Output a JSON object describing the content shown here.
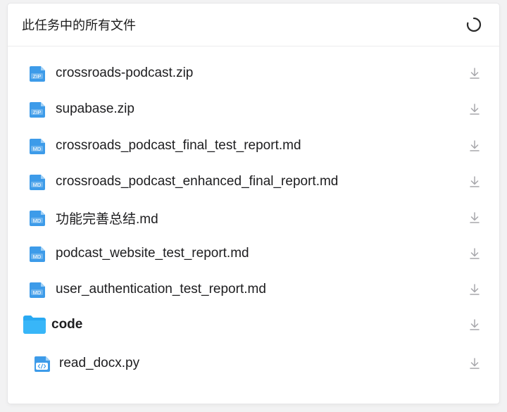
{
  "panel": {
    "title": "此任务中的所有文件",
    "refresh_icon": "loading-spinner-icon"
  },
  "files": [
    {
      "name": "crossroads-podcast.zip",
      "type": "zip",
      "badge": "ZIP"
    },
    {
      "name": "supabase.zip",
      "type": "zip",
      "badge": "ZIP"
    },
    {
      "name": "crossroads_podcast_final_test_report.md",
      "type": "md",
      "badge": "MD"
    },
    {
      "name": "crossroads_podcast_enhanced_final_report.md",
      "type": "md",
      "badge": "MD"
    },
    {
      "name": "功能完善总结.md",
      "type": "md",
      "badge": "MD"
    },
    {
      "name": "podcast_website_test_report.md",
      "type": "md",
      "badge": "MD"
    },
    {
      "name": "user_authentication_test_report.md",
      "type": "md",
      "badge": "MD"
    },
    {
      "name": "code",
      "type": "folder"
    },
    {
      "name": "read_docx.py",
      "type": "code",
      "nested": true
    }
  ],
  "colors": {
    "icon_blue": "#3d9be9",
    "folder_blue": "#29a9f2",
    "download_gray": "#a7a7ab"
  },
  "icons": {
    "download": "download-icon",
    "zip": "zip-file-icon",
    "md": "markdown-file-icon",
    "folder": "folder-icon",
    "code": "code-file-icon"
  }
}
